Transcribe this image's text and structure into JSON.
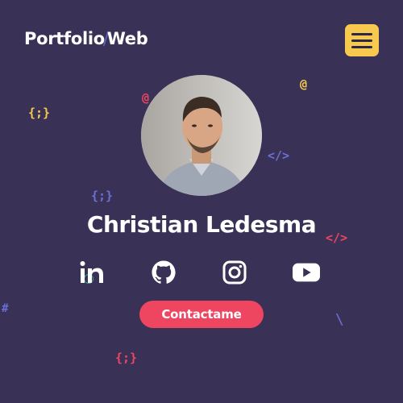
{
  "header": {
    "logo_part1": "Portfolio",
    "logo_slash": "/",
    "logo_part2": "Web",
    "menu_icon": "hamburger-menu-icon"
  },
  "profile": {
    "name": "Christian Ledesma",
    "photo": "profile-photo"
  },
  "social": [
    {
      "icon": "linkedin-icon"
    },
    {
      "icon": "github-icon"
    },
    {
      "icon": "instagram-icon"
    },
    {
      "icon": "youtube-icon"
    }
  ],
  "cta": {
    "label": "Contactame"
  },
  "decorations": {
    "braces_1": "{;}",
    "braces_2": "{;}",
    "braces_3": "{;}",
    "at_1": "@",
    "at_2": "@",
    "code_tag_1": "</>",
    "code_tag_2": "</>",
    "hash": "#",
    "backslash": "\\"
  },
  "colors": {
    "background": "#393256",
    "accent_yellow": "#f8c94f",
    "accent_pink": "#ee4561",
    "accent_blue": "#5b62c9"
  }
}
